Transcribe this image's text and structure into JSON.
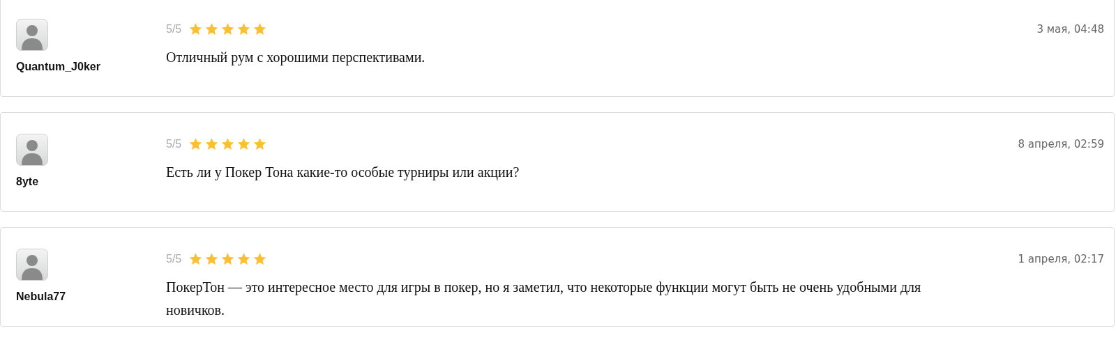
{
  "reviews": [
    {
      "author": "Quantum_J0ker",
      "score": "5/5",
      "stars": 5,
      "date": "3 мая, 04:48",
      "text": "Отличный рум с хорошими перспективами."
    },
    {
      "author": "8yte",
      "score": "5/5",
      "stars": 5,
      "date": "8 апреля, 02:59",
      "text": "Есть ли у Покер Тона какие-то особые турниры или акции?"
    },
    {
      "author": "Nebula77",
      "score": "5/5",
      "stars": 5,
      "date": "1 апреля, 02:17",
      "text": "ПокерТон — это интересное место для игры в покер, но я заметил, что некоторые функции могут быть не очень удобными для новичков."
    }
  ]
}
